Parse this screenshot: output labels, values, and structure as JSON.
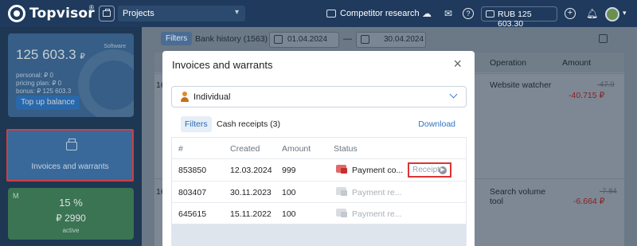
{
  "header": {
    "logo_text": "Topvisor",
    "logo_mark": "®",
    "project_select": "Projects",
    "competitor_research": "Competitor research",
    "balance": "RUB 125 603.30",
    "icons": [
      "briefcase-icon",
      "cloud-upload-icon",
      "mail-icon",
      "help-icon",
      "wallet-icon",
      "plus-icon",
      "bell-icon",
      "avatar"
    ]
  },
  "sidebar": {
    "balance_card": {
      "amount": "125 603.3",
      "currency": "₽",
      "software_label": "Software",
      "personal": "personal:   ₽ 0",
      "pricing_plan": "pricing plan: ₽ 0",
      "bonus": "bonus: ₽ 125 603.3",
      "topup_label": "Top up balance"
    },
    "invoices_card": {
      "label": "Invoices and warrants"
    },
    "percent_card": {
      "badge": "M",
      "percent": "15 %",
      "amount": "₽ 2990",
      "status": "active"
    }
  },
  "main": {
    "filters_label": "Filters",
    "bank_history": "Bank history  (1563)",
    "date_from": "01.04.2024",
    "date_to": "30.04.2024",
    "date_separator": "—",
    "table": {
      "columns": {
        "operation": "Operation",
        "amount": "Amount"
      },
      "rows": [
        {
          "id": "16",
          "operation": "Website watcher",
          "amount_old": "-47.9",
          "amount": "-40.715 ₽"
        },
        {
          "id": "16",
          "operation": "Search volume tool",
          "amount_old": "-7.84",
          "amount": "-6.664 ₽"
        }
      ]
    }
  },
  "modal": {
    "title": "Invoices and warrants",
    "close_icon": "×",
    "payer_select": "Individual",
    "filters_label": "Filters",
    "cash_receipts": "Cash receipts  (3)",
    "download_label": "Download",
    "columns": {
      "num": "#",
      "created": "Created",
      "amount": "Amount",
      "status": "Status"
    },
    "rows": [
      {
        "num": "853850",
        "created": "12.03.2024",
        "amount": "999",
        "status": "Payment co...",
        "active": true,
        "receipt": "Receipt"
      },
      {
        "num": "803407",
        "created": "30.11.2023",
        "amount": "100",
        "status": "Payment re...",
        "active": false
      },
      {
        "num": "645615",
        "created": "15.11.2022",
        "amount": "100",
        "status": "Payment re...",
        "active": false
      }
    ]
  }
}
